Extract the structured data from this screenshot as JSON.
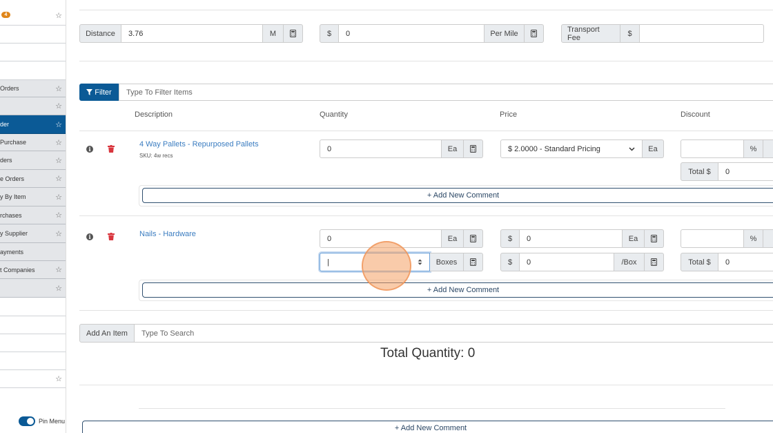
{
  "sidebar": {
    "badge": "4",
    "items": [
      {
        "label": "",
        "star": true,
        "style": "white"
      },
      {
        "label": "",
        "star": false,
        "style": "white"
      },
      {
        "label": "",
        "star": false,
        "style": "white"
      },
      {
        "label": "",
        "star": false,
        "style": "white"
      },
      {
        "label": "Orders",
        "star": true,
        "style": "gray"
      },
      {
        "label": "",
        "star": true,
        "style": "gray"
      },
      {
        "label": "der",
        "star": true,
        "style": "active"
      },
      {
        "label": "Purchase",
        "star": true,
        "style": "gray"
      },
      {
        "label": "ders",
        "star": true,
        "style": "gray"
      },
      {
        "label": "e Orders",
        "star": true,
        "style": "gray"
      },
      {
        "label": "y By Item",
        "star": true,
        "style": "gray"
      },
      {
        "label": "rchases",
        "star": true,
        "style": "gray"
      },
      {
        "label": "y Supplier",
        "star": true,
        "style": "gray"
      },
      {
        "label": "ayments",
        "star": false,
        "style": "gray"
      },
      {
        "label": "t Companies",
        "star": true,
        "style": "gray"
      },
      {
        "label": "",
        "star": true,
        "style": "gray"
      },
      {
        "label": "",
        "star": false,
        "style": "white"
      },
      {
        "label": "",
        "star": false,
        "style": "white"
      },
      {
        "label": "",
        "star": false,
        "style": "white"
      },
      {
        "label": "",
        "star": false,
        "style": "white"
      },
      {
        "label": "",
        "star": true,
        "style": "white"
      }
    ],
    "pin_label": "Pin Menu"
  },
  "transport": {
    "distance_label": "Distance",
    "distance_value": "3.76",
    "distance_unit": "M",
    "rate_prefix": "$",
    "rate_value": "0",
    "rate_unit": "Per Mile",
    "fee_label": "Transport Fee",
    "fee_prefix": "$",
    "fee_value": ""
  },
  "filter": {
    "button_label": "Filter",
    "placeholder": "Type To Filter Items"
  },
  "columns": {
    "description": "Description",
    "quantity": "Quantity",
    "price": "Price",
    "discount": "Discount"
  },
  "items": [
    {
      "name": "4 Way Pallets - Repurposed Pallets",
      "sku": "SKU: 4w recs",
      "qty": "0",
      "qty_unit": "Ea",
      "price_select": "$ 2.0000 - Standard Pricing",
      "price_unit": "Ea",
      "discount_value": "",
      "discount_unit": "%",
      "total_label": "Total $",
      "total_value": "0",
      "comment_label": "+ Add New Comment"
    },
    {
      "name": "Nails - Hardware",
      "qty": "0",
      "qty_unit": "Ea",
      "box_qty": "|",
      "box_unit": "Boxes",
      "price_prefix": "$",
      "price_value": "0",
      "price_unit": "Ea",
      "box_price_prefix": "$",
      "box_price_value": "0",
      "box_price_unit": "/Box",
      "discount_value": "",
      "discount_unit": "%",
      "total_label": "Total $",
      "total_value": "0",
      "comment_label": "+ Add New Comment"
    }
  ],
  "add_item": {
    "button_label": "Add An Item",
    "placeholder": "Type To Search"
  },
  "total_quantity": "Total Quantity:  0",
  "bottom_comment_label": "+ Add New Comment",
  "colors": {
    "primary": "#0b5a96",
    "link": "#3a7cc0",
    "danger": "#d9363e",
    "badge": "#e0861a"
  }
}
